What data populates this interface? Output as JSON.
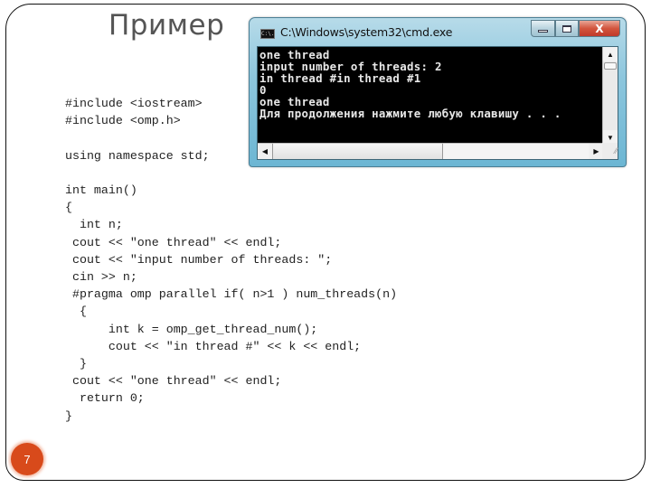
{
  "slide": {
    "title": "Пример",
    "page_number": "7",
    "code_header": [
      "#include <iostream>",
      "#include <omp.h>",
      "",
      "using namespace std;"
    ],
    "code_main": [
      "int main()",
      "{",
      "  int n;",
      " cout << \"one thread\" << endl;",
      " cout << \"input number of threads: \";",
      " cin >> n;",
      " #pragma omp parallel if( n>1 ) num_threads(n)",
      "  {",
      "      int k = omp_get_thread_num();",
      "      cout << \"in thread #\" << k << endl;",
      "  }",
      " cout << \"one thread\" << endl;",
      "  return 0;",
      "}"
    ]
  },
  "cmd_window": {
    "icon": "cmd-icon",
    "icon_text": "C:\\.",
    "title": "C:\\Windows\\system32\\cmd.exe",
    "buttons": {
      "minimize": "minimize-icon",
      "maximize": "maximize-icon",
      "close": "X"
    },
    "output_lines": [
      "one thread",
      "input number of threads: 2",
      "in thread #in thread #1",
      "0",
      "one thread",
      "Для продолжения нажмите любую клавишу . . ."
    ],
    "scroll_glyphs": {
      "up": "▲",
      "down": "▼",
      "left": "◀",
      "right": "▶",
      "grip": "⁄⁄"
    }
  }
}
